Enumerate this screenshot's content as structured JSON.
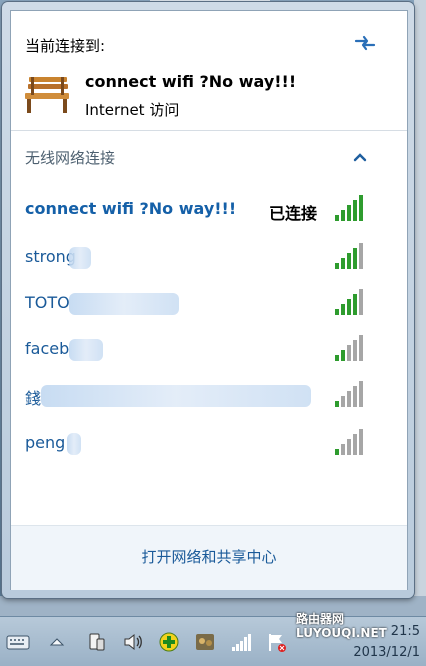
{
  "current": {
    "header": "当前连接到:",
    "name": "connect  wifi ?No way!!!",
    "access": "Internet 访问"
  },
  "wireless": {
    "section_title": "无线网络连接",
    "networks": [
      {
        "name": "connect  wifi ?No way!!!",
        "status": "已连接",
        "signal_bars": 5
      },
      {
        "name": "strong",
        "signal_bars": 4
      },
      {
        "name": "TOTO",
        "signal_bars": 4
      },
      {
        "name": "faceb",
        "signal_bars": 2
      },
      {
        "name": "錢",
        "signal_bars": 1
      },
      {
        "name": "peng",
        "signal_bars": 1
      }
    ]
  },
  "footer": {
    "link": "打开网络和共享中心"
  },
  "taskbar": {
    "time": "21:5",
    "date": "2013/12/1"
  },
  "watermark": {
    "line1": "路由器网",
    "line2": "LUYOUQI.NET"
  },
  "colors": {
    "link": "#1a5a99",
    "signal_on": "#2e9c2e",
    "signal_off": "#a6a6a6"
  }
}
